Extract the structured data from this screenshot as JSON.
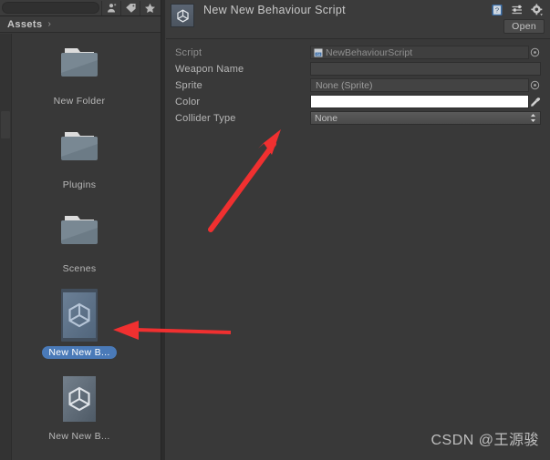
{
  "app": {
    "name": "Unity Editor",
    "theme_background": "#383838",
    "accent_selection": "#4a7ab8",
    "annotation_color": "#f03030"
  },
  "project_panel": {
    "toolbar": {
      "search_placeholder": "",
      "search_value": "",
      "buttons": [
        {
          "name": "avatar-filter-icon",
          "label": ""
        },
        {
          "name": "label-filter-icon",
          "label": ""
        },
        {
          "name": "favorite-filter-icon",
          "label": ""
        }
      ]
    },
    "breadcrumb": {
      "root_label": "Assets",
      "chevron": "›"
    },
    "assets": [
      {
        "label": "New Folder",
        "type": "folder",
        "selected": false
      },
      {
        "label": "Plugins",
        "type": "folder",
        "selected": false
      },
      {
        "label": "Scenes",
        "type": "folder",
        "selected": false
      },
      {
        "label": "New New B...",
        "type": "script",
        "selected": true
      },
      {
        "label": "New New B...",
        "type": "script",
        "selected": false
      }
    ]
  },
  "inspector": {
    "title": "New New Behaviour Script",
    "icon_name": "unity-asset-icon",
    "header_buttons": [
      {
        "name": "help-icon",
        "label": ""
      },
      {
        "name": "preset-icon",
        "label": ""
      },
      {
        "name": "settings-gear-icon",
        "label": ""
      }
    ],
    "open_button_label": "Open",
    "properties": [
      {
        "label": "Script",
        "control": "object",
        "value": "NewBehaviourScript",
        "readonly": true,
        "has_picker": true,
        "icon": "cs-script-icon"
      },
      {
        "label": "Weapon Name",
        "control": "text",
        "value": "",
        "readonly": false,
        "has_picker": false
      },
      {
        "label": "Sprite",
        "control": "object",
        "value": "None (Sprite)",
        "readonly": false,
        "has_picker": true,
        "icon": ""
      },
      {
        "label": "Color",
        "control": "color",
        "value": "#ffffff",
        "readonly": false,
        "has_picker": false
      },
      {
        "label": "Collider Type",
        "control": "dropdown",
        "value": "None",
        "readonly": false,
        "has_picker": false
      }
    ]
  },
  "watermark": {
    "text": "CSDN @王源骏"
  },
  "annotations": [
    {
      "name": "arrow-to-properties",
      "direction": "up-right"
    },
    {
      "name": "arrow-to-selected-asset",
      "direction": "left"
    }
  ]
}
